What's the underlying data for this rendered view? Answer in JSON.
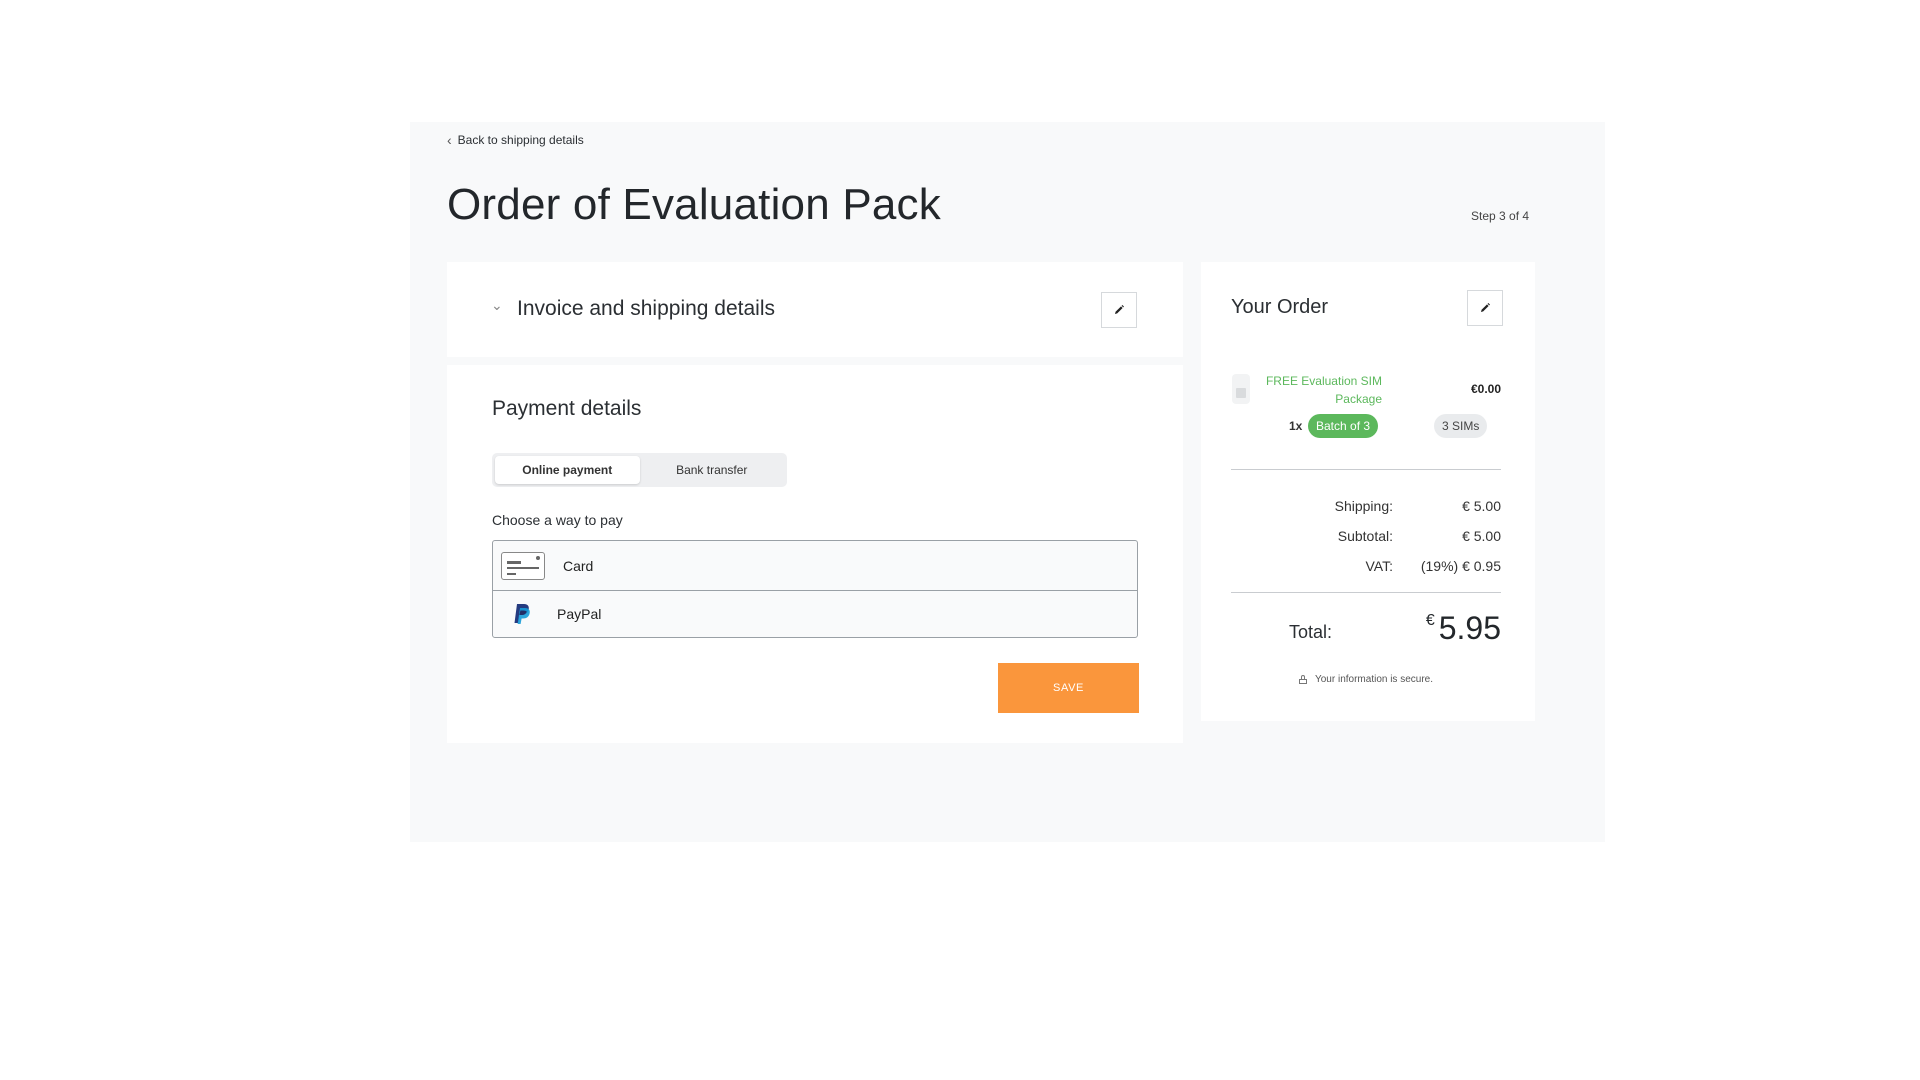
{
  "back_link": {
    "label": "Back to shipping details"
  },
  "page": {
    "title": "Order of Evaluation Pack",
    "step": "Step 3 of 4"
  },
  "invoice": {
    "title": "Invoice and shipping details"
  },
  "payment": {
    "title": "Payment details",
    "tabs": [
      {
        "label": "Online payment",
        "active": true
      },
      {
        "label": "Bank transfer",
        "active": false
      }
    ],
    "choose_label": "Choose a way to pay",
    "methods": [
      {
        "label": "Card",
        "icon": "credit-card-icon"
      },
      {
        "label": "PayPal",
        "icon": "paypal-icon"
      }
    ],
    "save_label": "SAVE"
  },
  "order": {
    "title": "Your Order",
    "item": {
      "name": "FREE Evaluation SIM Package",
      "price": "€0.00",
      "qty": "1x",
      "batch": "Batch of 3",
      "sims": "3 SIMs"
    },
    "summary": [
      {
        "label": "Shipping:",
        "value": "€ 5.00"
      },
      {
        "label": "Subtotal:",
        "value": "€ 5.00"
      },
      {
        "label": "VAT:",
        "value": "(19%) € 0.95"
      }
    ],
    "total_label": "Total:",
    "total_currency": "€",
    "total_value": "5.95",
    "secure_text": "Your information is secure."
  },
  "colors": {
    "accent_orange": "#fa963c",
    "success_green": "#5cb85c",
    "panel_bg": "#f8f9fa"
  }
}
